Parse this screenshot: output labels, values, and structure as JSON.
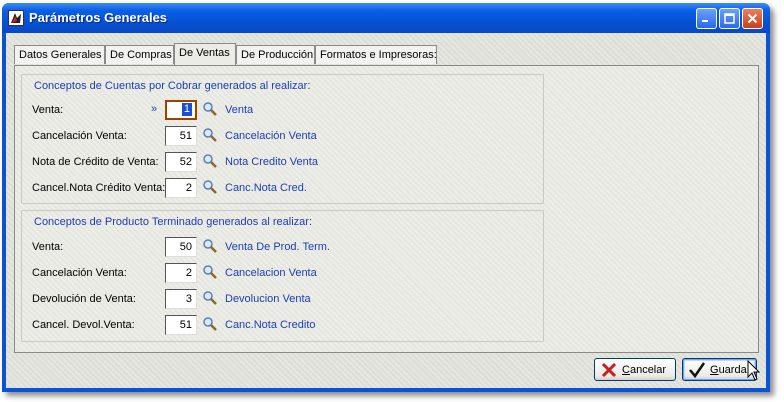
{
  "window": {
    "title": "Parámetros Generales"
  },
  "tabs": [
    {
      "label": "Datos Generales"
    },
    {
      "label": "De Compras"
    },
    {
      "label": "De Ventas"
    },
    {
      "label": "De Producción"
    },
    {
      "label": "Formatos e Impresoras:"
    }
  ],
  "active_tab": "De Ventas",
  "cuentas_group": {
    "title": "Conceptos de Cuentas por Cobrar generados al realizar:",
    "rows": [
      {
        "label": "Venta:",
        "marker": "»",
        "value": "1",
        "desc": "Venta"
      },
      {
        "label": "Cancelación Venta:",
        "value": "51",
        "desc": "Cancelación Venta"
      },
      {
        "label": "Nota de Crédito de Venta:",
        "value": "52",
        "desc": "Nota Credito Venta"
      },
      {
        "label": "Cancel.Nota Crédito Venta:",
        "value": "2",
        "desc": "Canc.Nota Cred."
      }
    ]
  },
  "producto_group": {
    "title": "Conceptos de Producto Terminado  generados al realizar:",
    "rows": [
      {
        "label": "Venta:",
        "value": "50",
        "desc": "Venta De Prod. Term."
      },
      {
        "label": "Cancelación Venta:",
        "value": "2",
        "desc": "Cancelacion Venta"
      },
      {
        "label": "Devolución de Venta:",
        "value": "3",
        "desc": "Devolucion Venta"
      },
      {
        "label": "Cancel. Devol.Venta:",
        "value": "51",
        "desc": "Canc.Nota Credito"
      }
    ]
  },
  "buttons": {
    "cancel_first": "C",
    "cancel_rest": "ancelar",
    "save_first": "G",
    "save_rest": "uardar"
  },
  "icons": {
    "lookup": "magnifier-icon",
    "cancel": "red-x-icon",
    "save": "checkmark-icon"
  },
  "colors": {
    "title_bar": "#0653d7",
    "link_text": "#1a3fb0",
    "focus_border": "#a04000"
  }
}
